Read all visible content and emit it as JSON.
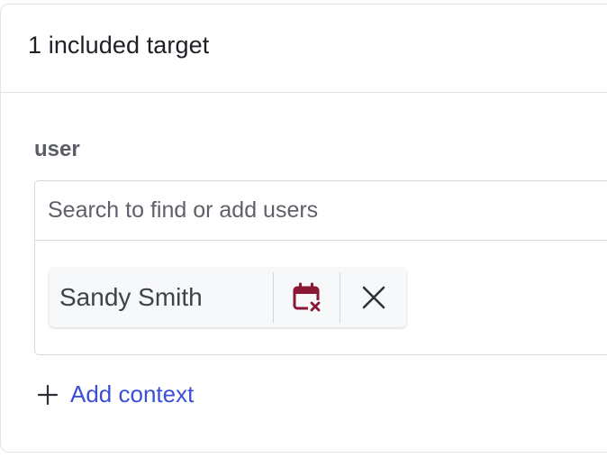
{
  "header": {
    "title": "1 included target"
  },
  "section": {
    "label": "user"
  },
  "search": {
    "placeholder": "Search to find or add users",
    "value": ""
  },
  "targets": [
    {
      "name": "Sandy Smith",
      "schedule_icon": "calendar-remove-icon",
      "remove_icon": "close-icon"
    }
  ],
  "actions": {
    "add_context_label": "Add context",
    "add_context_icon": "plus-icon"
  },
  "colors": {
    "accent": "#3a4fd6",
    "calendar_icon": "#8a1733",
    "border": "#d6d8dd",
    "text": "#1f2027"
  }
}
